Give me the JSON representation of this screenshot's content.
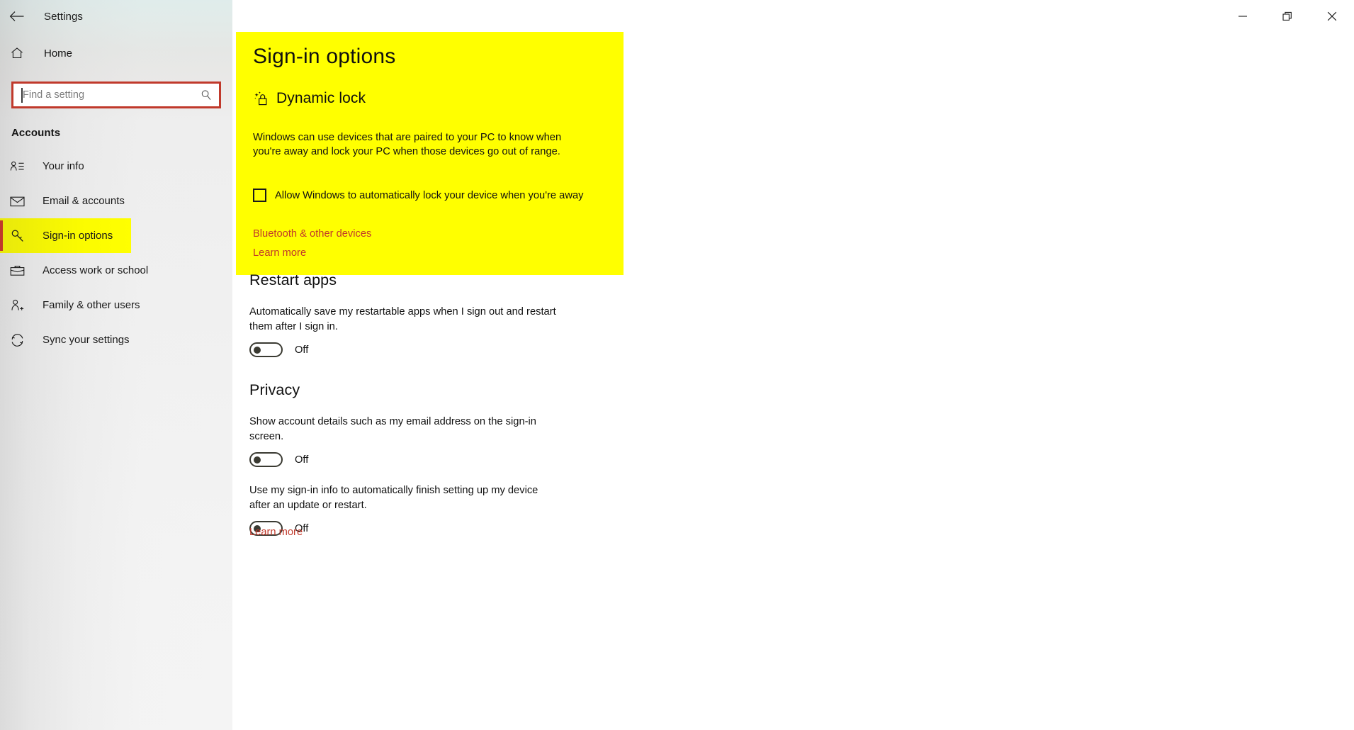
{
  "window": {
    "app_title": "Settings",
    "back_icon": "back-arrow-icon",
    "minimize_label": "Minimize",
    "restore_label": "Restore",
    "close_label": "Close"
  },
  "sidebar": {
    "home": {
      "label": "Home",
      "icon": "home-icon"
    },
    "search": {
      "placeholder": "Find a setting",
      "value": "",
      "icon": "search-icon"
    },
    "section_label": "Accounts",
    "items": [
      {
        "label": "Your info",
        "icon": "user-details-icon",
        "selected": false
      },
      {
        "label": "Email & accounts",
        "icon": "envelope-icon",
        "selected": false
      },
      {
        "label": "Sign-in options",
        "icon": "key-icon",
        "selected": true
      },
      {
        "label": "Access work or school",
        "icon": "briefcase-icon",
        "selected": false
      },
      {
        "label": "Family & other users",
        "icon": "user-add-icon",
        "selected": false
      },
      {
        "label": "Sync your settings",
        "icon": "sync-icon",
        "selected": false
      }
    ]
  },
  "main": {
    "page_title": "Sign-in options",
    "dynamic_lock": {
      "heading": "Dynamic lock",
      "icon": "dynamic-lock-icon",
      "description": "Windows can use devices that are paired to your PC to know when you're away and lock your PC when those devices go out of range.",
      "checkbox_label": "Allow Windows to automatically lock your device when you're away",
      "checkbox_checked": false,
      "link_bluetooth": "Bluetooth & other devices",
      "link_learn_more": "Learn more"
    },
    "restart_apps": {
      "title": "Restart apps",
      "description": "Automatically save my restartable apps when I sign out and restart them after I sign in.",
      "toggle_state": "Off",
      "toggle_on": false
    },
    "privacy": {
      "title": "Privacy",
      "setting_1": {
        "description": "Show account details such as my email address on the sign-in screen.",
        "toggle_state": "Off",
        "toggle_on": false
      },
      "setting_2": {
        "description": "Use my sign-in info to automatically finish setting up my device after an update or restart.",
        "toggle_state": "Off",
        "toggle_on": false
      },
      "link_learn_more": "Learn more"
    }
  },
  "colors": {
    "highlight_yellow": "#ffff00",
    "accent_red": "#c0392b",
    "link_red": "#c0392b",
    "text_dark": "#111111"
  }
}
